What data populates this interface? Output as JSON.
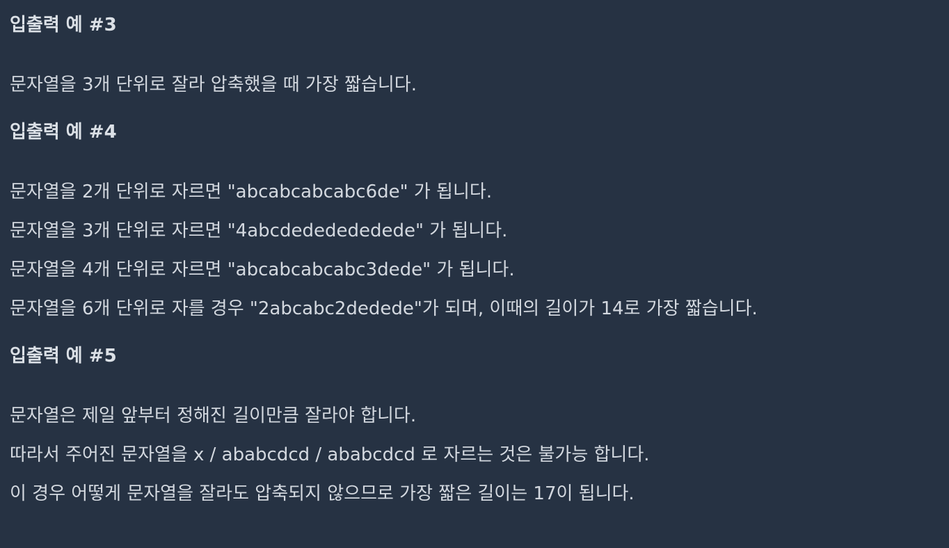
{
  "sections": [
    {
      "title": "입출력 예 #3",
      "lines": [
        "문자열을 3개 단위로 잘라 압축했을 때 가장 짧습니다."
      ]
    },
    {
      "title": "입출력 예 #4",
      "lines": [
        "문자열을 2개 단위로 자르면 \"abcabcabcabc6de\" 가 됩니다.",
        "문자열을 3개 단위로 자르면 \"4abcdededededede\" 가 됩니다.",
        "문자열을 4개 단위로 자르면 \"abcabcabcabc3dede\" 가 됩니다.",
        "문자열을 6개 단위로 자를 경우 \"2abcabc2dedede\"가 되며, 이때의 길이가 14로 가장 짧습니다."
      ]
    },
    {
      "title": "입출력 예 #5",
      "lines": [
        "문자열은 제일 앞부터 정해진 길이만큼 잘라야 합니다.",
        "따라서 주어진 문자열을 x / ababcdcd / ababcdcd 로 자르는 것은 불가능 합니다.",
        "이 경우 어떻게 문자열을 잘라도 압축되지 않으므로 가장 짧은 길이는 17이 됩니다."
      ]
    }
  ]
}
